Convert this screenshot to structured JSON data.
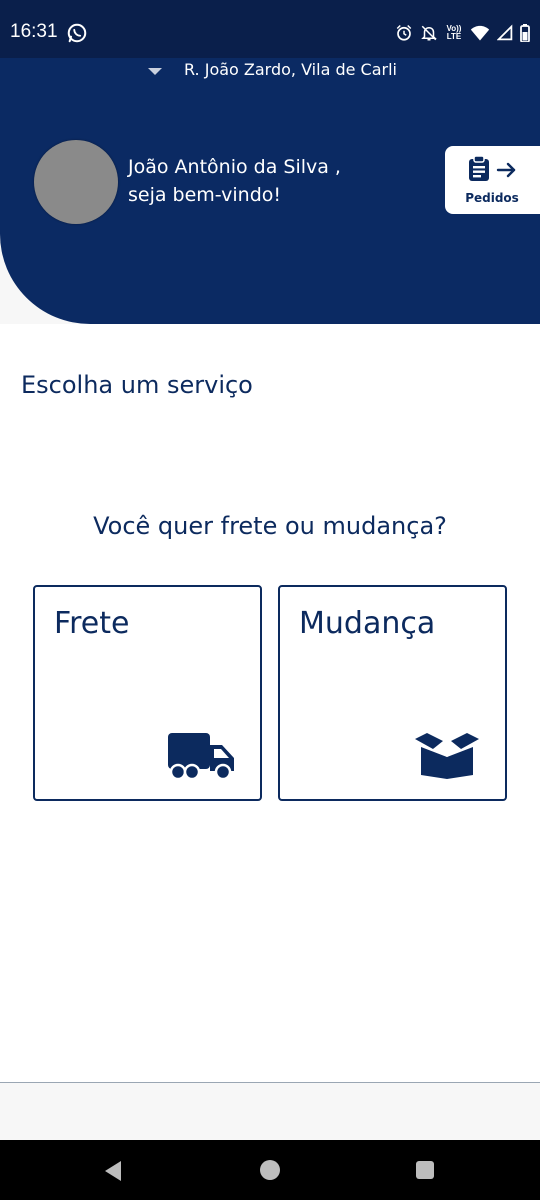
{
  "status_bar": {
    "time": "16:31",
    "app_icon": "whatsapp-icon",
    "volte_top": "Vo))",
    "volte_bottom": "LTE",
    "icons": [
      "alarm-icon",
      "notifications-off-icon",
      "wifi-icon",
      "signal-icon",
      "battery-icon"
    ]
  },
  "header": {
    "address": "R. João Zardo, Vila de Carli",
    "greeting_name": "João Antônio da Silva ,",
    "greeting_sub": "seja bem-vindo!",
    "orders_button_label": "Pedidos",
    "orders_button_icons": [
      "clipboard-icon",
      "arrow-right-icon"
    ],
    "colors": {
      "primary": "#0b2a63",
      "status_bar": "#0a1f4b"
    }
  },
  "main": {
    "section_title": "Escolha um serviço",
    "question": "Você quer frete ou mudança?",
    "cards": [
      {
        "label": "Frete",
        "icon": "truck-icon"
      },
      {
        "label": "Mudança",
        "icon": "box-icon"
      }
    ]
  },
  "nav_bar": {
    "buttons": [
      "back-icon",
      "home-icon",
      "recents-icon"
    ]
  }
}
